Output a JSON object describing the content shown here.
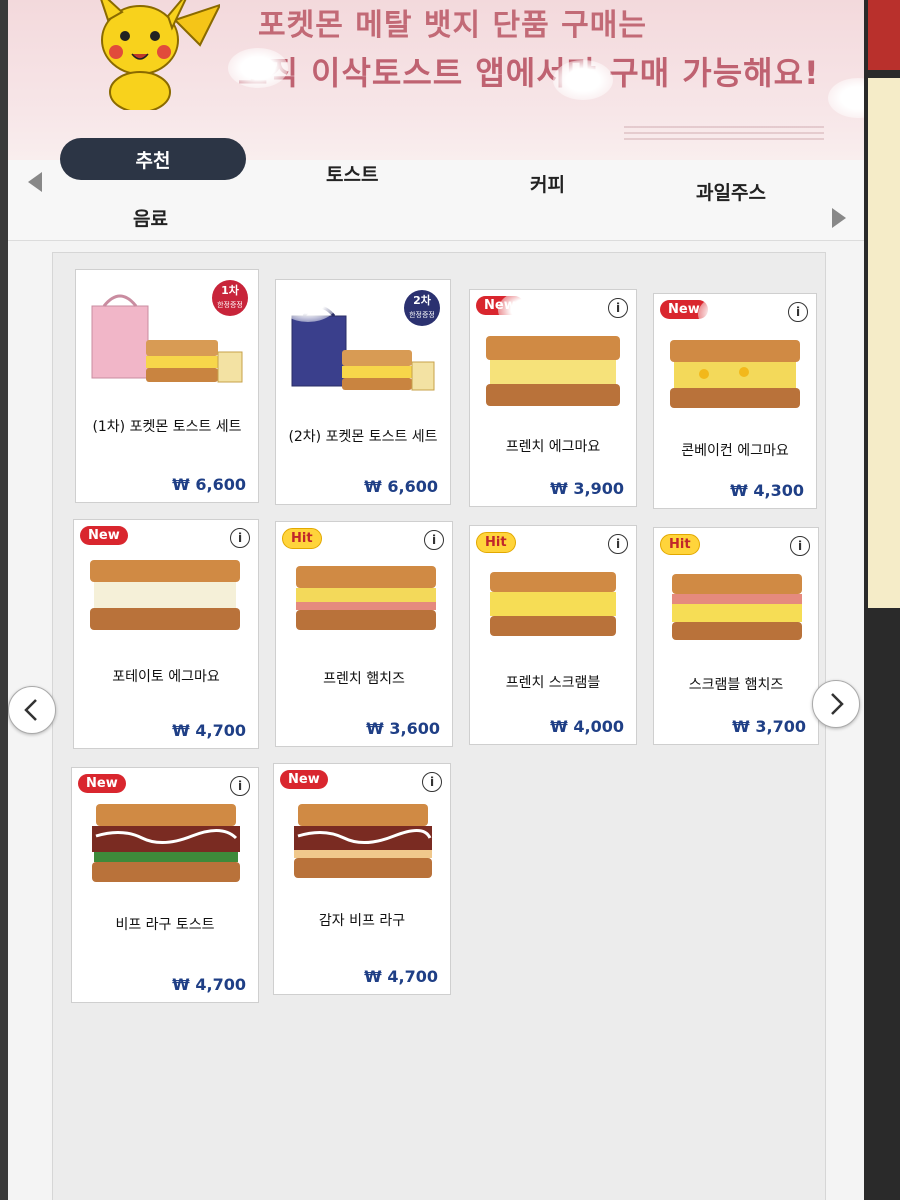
{
  "banner": {
    "line1": "포켓몬 메탈 뱃지 단품 구매는",
    "line2": "오직 이삭토스트 앱에서만 구매 가능해요!"
  },
  "tabs": [
    {
      "label": "추천",
      "active": true
    },
    {
      "label": "토스트",
      "active": false
    },
    {
      "label": "커피",
      "active": false
    },
    {
      "label": "과일주스",
      "active": false
    },
    {
      "label": "음료",
      "active": false
    }
  ],
  "products": [
    {
      "name": "(1차) 포켓몬 토스트 세트",
      "price": "₩ 6,600",
      "badge": "1차",
      "badge_sub": "한정증정"
    },
    {
      "name": "(2차) 포켓몬 토스트 세트",
      "price": "₩ 6,600",
      "badge": "2차",
      "badge_sub": "한정증정"
    },
    {
      "name": "프렌치 에그마요",
      "price": "₩ 3,900",
      "badge": "New"
    },
    {
      "name": "콘베이컨 에그마요",
      "price": "₩ 4,300",
      "badge": "New"
    },
    {
      "name": "포테이토 에그마요",
      "price": "₩ 4,700",
      "badge": "New"
    },
    {
      "name": "프렌치 햄치즈",
      "price": "₩ 3,600",
      "badge": "Hit"
    },
    {
      "name": "프렌치 스크램블",
      "price": "₩ 4,000",
      "badge": "Hit"
    },
    {
      "name": "스크램블 햄치즈",
      "price": "₩ 3,700",
      "badge": "Hit"
    },
    {
      "name": "비프 라구 토스트",
      "price": "₩ 4,700",
      "badge": "New"
    },
    {
      "name": "감자 비프 라구",
      "price": "₩ 4,700",
      "badge": "New"
    }
  ],
  "info_glyph": "i",
  "icons": {
    "prev": "chevron-left-icon",
    "next": "chevron-right-icon",
    "info": "info-icon"
  },
  "colors": {
    "active_tab": "#2c3545",
    "price": "#1f3f86",
    "new_badge": "#d9262e",
    "hit_badge": "#ffd43b"
  }
}
